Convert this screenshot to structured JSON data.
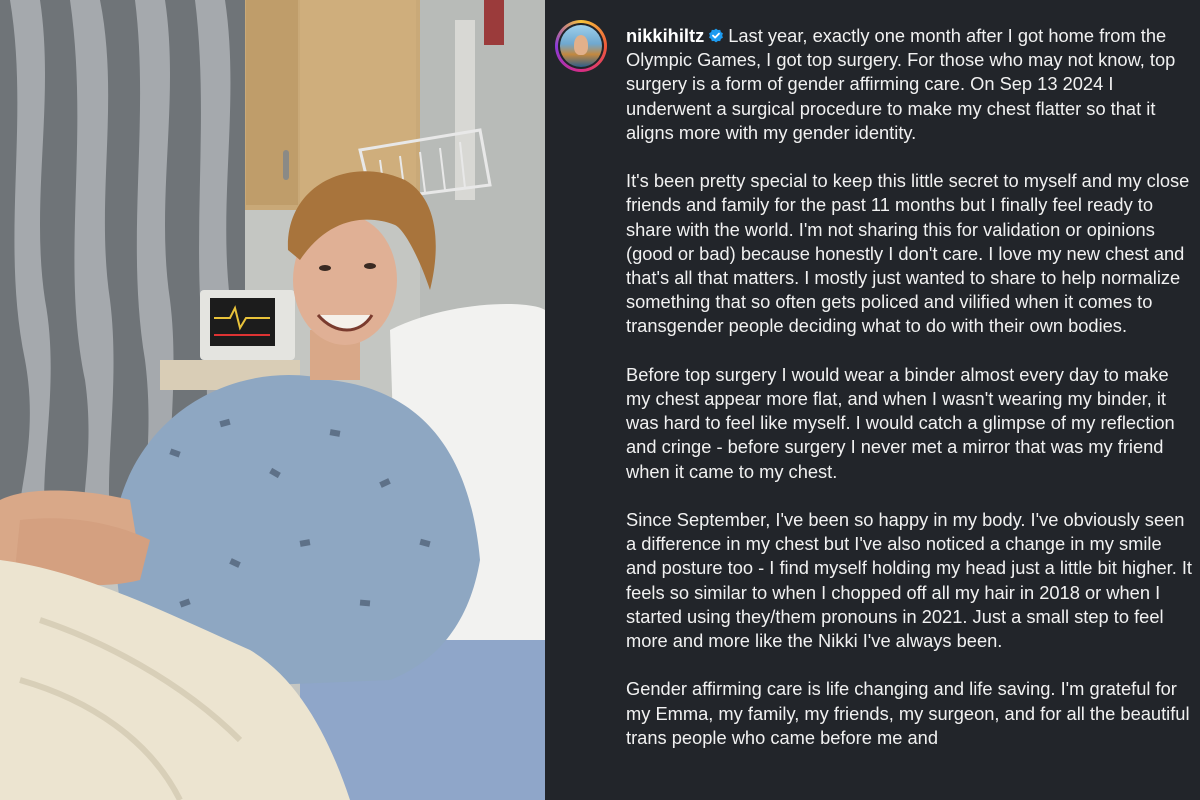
{
  "post": {
    "username": "nikkihiltz",
    "verified_icon": "verified-badge-icon",
    "verified_color": "#1d9bf0",
    "caption_paragraphs": [
      "Last year, exactly one month after I got home from the Olympic Games, I got top surgery. For those who may not know, top surgery is a form of gender affirming care. On Sep 13 2024 I underwent a surgical procedure to make my chest flatter so that it aligns more with my gender identity.",
      "It's been pretty special to keep this little secret to myself and my close friends and family for the past 11 months but I finally feel ready to share with the world. I'm not sharing this for validation or opinions (good or bad) because honestly I don't care. I love my new chest and that's all that matters. I mostly just wanted to share to help normalize something that so often gets policed and vilified when it comes to transgender people deciding what to do with their own bodies.",
      "Before top surgery I would wear a binder almost every day to make my chest appear more flat, and when I wasn't wearing my binder, it was hard to feel like myself. I would catch a glimpse of my reflection and cringe - before surgery I never met a mirror that was my friend when it came to my chest.",
      "Since September, I've been so happy in my body. I've obviously seen a difference in my chest but I've also noticed a change in my smile and posture too - I find myself holding my head just a little bit higher. It feels so similar to when I chopped off all my hair in 2018 or when I started using they/them pronouns in 2021. Just a small step to feel more and more like the Nikki I've always been.",
      "Gender affirming care is life changing and life saving. I'm grateful for my Emma, my family, my friends, my surgeon, and for all the beautiful trans people who came before me and"
    ]
  },
  "colors": {
    "panel_bg": "#22252a",
    "text": "#f1f1f1"
  }
}
